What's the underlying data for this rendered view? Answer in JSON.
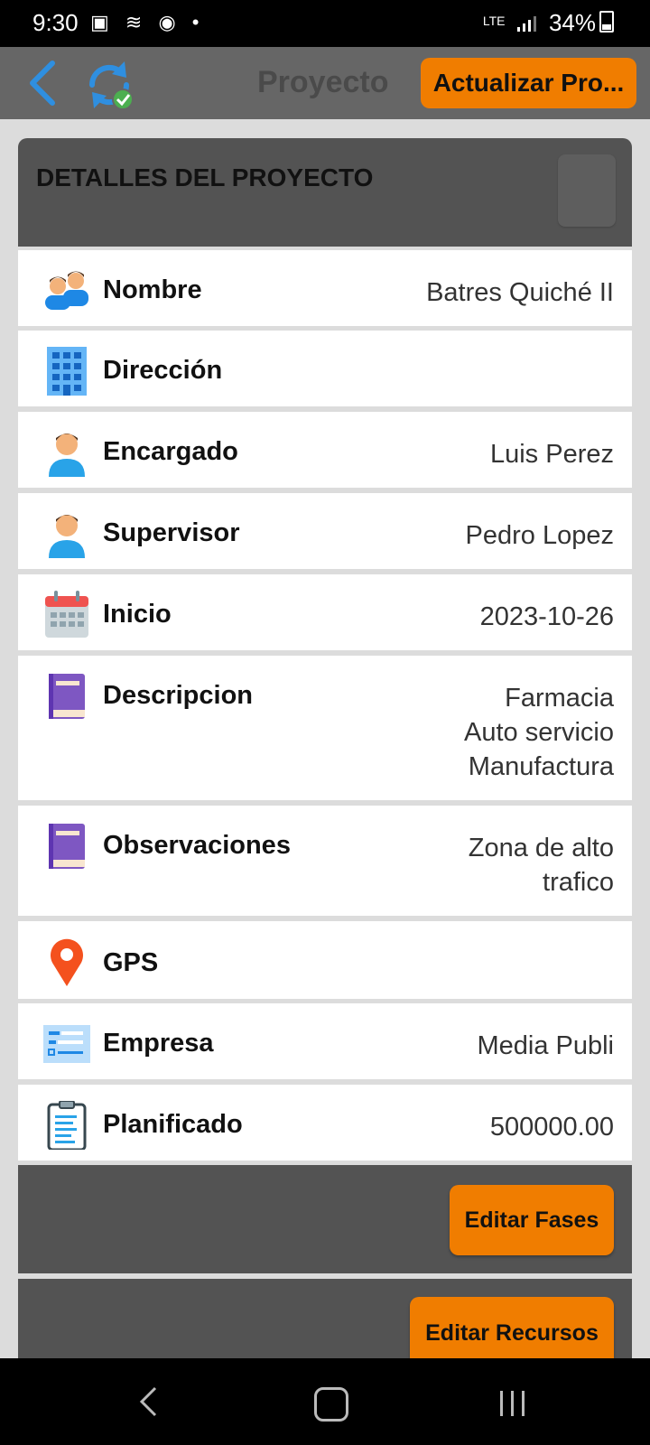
{
  "status_bar": {
    "time": "9:30",
    "network": "LTE",
    "battery": "34%"
  },
  "top_bar": {
    "title": "Proyecto",
    "update_button": "Actualizar Pro..."
  },
  "card": {
    "header": "DETALLES DEL PROYECTO"
  },
  "rows": [
    {
      "label": "Nombre",
      "value": "Batres Quiché II",
      "icon": "people-icon"
    },
    {
      "label": "Dirección",
      "value": "",
      "icon": "building-icon"
    },
    {
      "label": "Encargado",
      "value": "Luis Perez",
      "icon": "person-icon"
    },
    {
      "label": "Supervisor",
      "value": "Pedro Lopez",
      "icon": "person-icon"
    },
    {
      "label": "Inicio",
      "value": "2023-10-26",
      "icon": "calendar-icon"
    },
    {
      "label": "Descripcion",
      "value": "Farmacia\nAuto servicio\nManufactura",
      "icon": "book-icon"
    },
    {
      "label": "Observaciones",
      "value": "Zona de alto\ntrafico",
      "icon": "book-icon"
    },
    {
      "label": "GPS",
      "value": "",
      "icon": "location-pin-icon"
    },
    {
      "label": "Empresa",
      "value": "Media Publi",
      "icon": "id-card-icon"
    },
    {
      "label": "Planificado",
      "value": "500000.00",
      "icon": "clipboard-icon"
    }
  ],
  "actions": {
    "edit_phases": "Editar Fases",
    "edit_resources": "Editar Recursos"
  },
  "colors": {
    "accent": "#f07d00",
    "top_bar": "#666666",
    "panel": "#535353",
    "sync_blue": "#2f8fe0",
    "check_green": "#4caf50"
  }
}
